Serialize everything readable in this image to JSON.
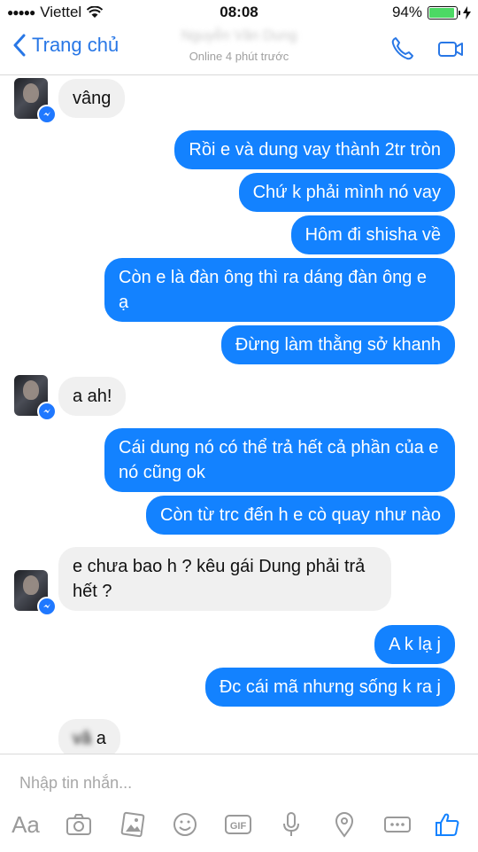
{
  "status": {
    "carrier": "Viettel",
    "time": "08:08",
    "battery": "94%",
    "battery_level": 0.94
  },
  "header": {
    "back_label": "Trang chủ",
    "contact_name": "Nguyễn Văn Dung",
    "presence": "Online 4 phút trước"
  },
  "messages": [
    {
      "dir": "in",
      "text": "vâng"
    },
    {
      "dir": "out",
      "text": "Rồi e và dung vay thành 2tr tròn"
    },
    {
      "dir": "out",
      "text": "Chứ k phải mình nó vay"
    },
    {
      "dir": "out",
      "text": "Hôm đi shisha về"
    },
    {
      "dir": "out",
      "text": "Còn e là đàn ông thì ra dáng đàn ông e ạ"
    },
    {
      "dir": "out",
      "text": "Đừng làm thằng sở khanh"
    },
    {
      "dir": "in",
      "text": "a ah!"
    },
    {
      "dir": "out",
      "text": "Cái dung nó có thể trả hết cả phần của e nó cũng ok"
    },
    {
      "dir": "out",
      "text": "Còn từ trc đến h e cò quay như nào"
    },
    {
      "dir": "in",
      "text": "e chưa bao h ? kêu gái Dung phải trả hết ?"
    },
    {
      "dir": "out",
      "text": "A k lạ j"
    },
    {
      "dir": "out",
      "text": "Đc cái mã nhưng sống k ra j"
    },
    {
      "dir": "in",
      "text": "vâ a",
      "blurred_part": "vâ",
      "visible_part": "a"
    }
  ],
  "composer": {
    "placeholder": "Nhập tin nhắn...",
    "aa_label": "Aa",
    "tools": [
      "text-format-icon",
      "camera-icon",
      "gallery-icon",
      "emoji-icon",
      "gif-icon",
      "microphone-icon",
      "location-icon",
      "more-icon",
      "like-icon"
    ]
  },
  "colors": {
    "accent": "#1382ff",
    "incoming": "#f0f0f0",
    "nav_blue": "#2877e6"
  }
}
